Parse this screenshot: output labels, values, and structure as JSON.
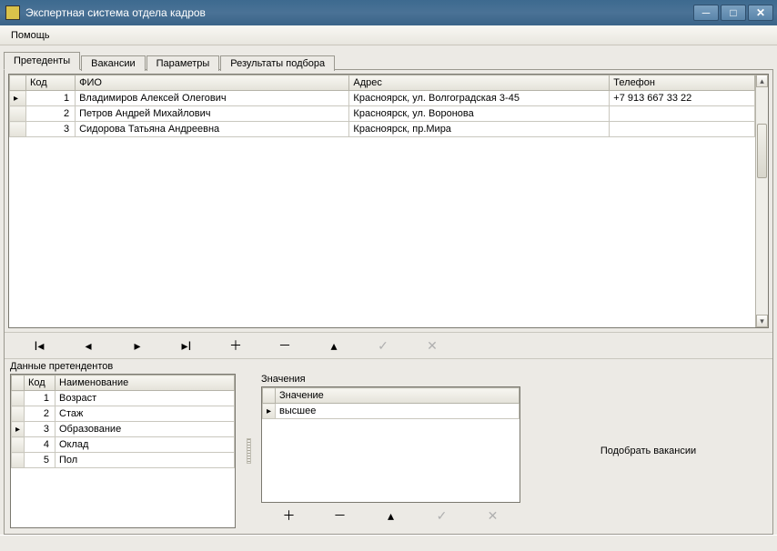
{
  "window": {
    "title": "Экспертная система отдела кадров"
  },
  "menu": {
    "help": "Помощь"
  },
  "tabs": [
    {
      "label": "Претеденты",
      "active": true
    },
    {
      "label": "Вакансии",
      "active": false
    },
    {
      "label": "Параметры",
      "active": false
    },
    {
      "label": "Результаты подбора",
      "active": false
    }
  ],
  "applicants": {
    "columns": {
      "code": "Код",
      "fio": "ФИО",
      "address": "Адрес",
      "phone": "Телефон"
    },
    "rows": [
      {
        "code": "1",
        "fio": "Владимиров Алексей Олегович",
        "address": "Красноярск, ул. Волгоградская 3-45",
        "phone": "+7 913 667 33 22"
      },
      {
        "code": "2",
        "fio": "Петров Андрей Михайлович",
        "address": "Красноярск, ул. Воронова",
        "phone": ""
      },
      {
        "code": "3",
        "fio": "Сидорова Татьяна Андреевна",
        "address": "Красноярск, пр.Мира",
        "phone": ""
      }
    ],
    "currentRow": 0
  },
  "sections": {
    "params_title": "Данные претендентов",
    "values_title": "Значения"
  },
  "params": {
    "columns": {
      "code": "Код",
      "name": "Наименование"
    },
    "rows": [
      {
        "code": "1",
        "name": "Возраст"
      },
      {
        "code": "2",
        "name": "Стаж"
      },
      {
        "code": "3",
        "name": "Образование"
      },
      {
        "code": "4",
        "name": "Оклад"
      },
      {
        "code": "5",
        "name": "Пол"
      }
    ],
    "currentRow": 2
  },
  "values": {
    "columns": {
      "value": "Значение"
    },
    "rows": [
      {
        "value": "высшее"
      }
    ],
    "currentRow": 0
  },
  "buttons": {
    "pick": "Подобрать вакансии"
  },
  "nav": {
    "first": "|◂",
    "prev": "◂",
    "next": "▸",
    "last": "▸|",
    "add": "+",
    "del": "−",
    "edit": "▴",
    "post": "✓",
    "cancel": "✕"
  }
}
